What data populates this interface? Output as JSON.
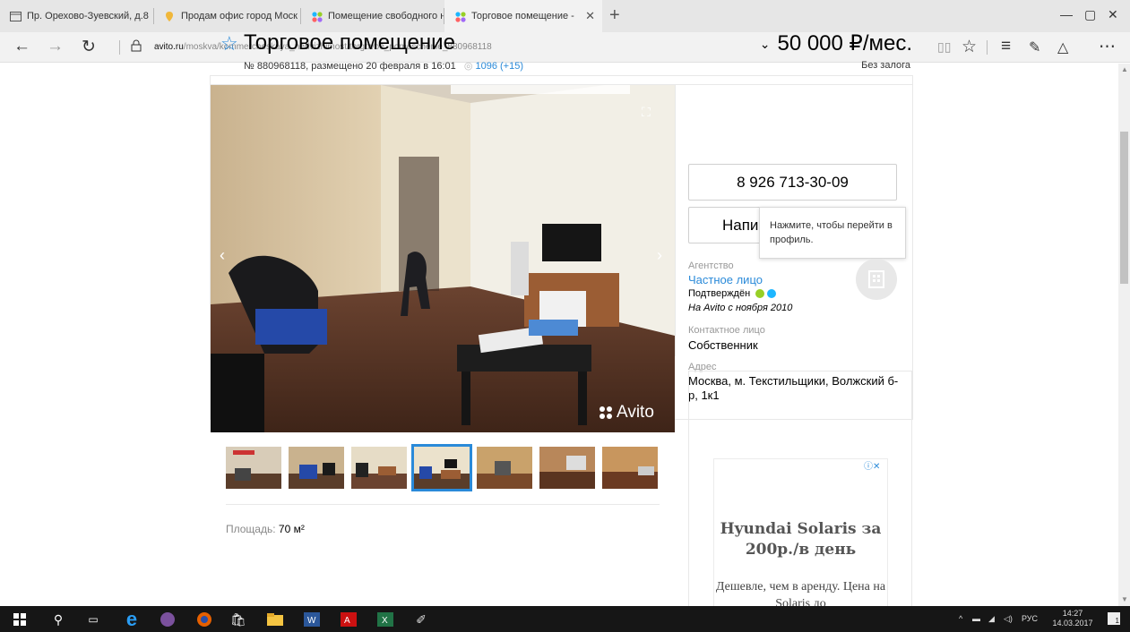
{
  "browser": {
    "tabs": [
      {
        "label": "Пр. Орехово-Зуевский, д.8",
        "icon": "page-icon"
      },
      {
        "label": "Продам офис город Моск",
        "icon": "map-pin-icon"
      },
      {
        "label": "Помещение свободного н",
        "icon": "avito-icon"
      },
      {
        "label": "Торговое помещение -",
        "icon": "avito-icon",
        "active": true
      }
    ],
    "url_domain": "avito.ru",
    "url_path": "/moskva/kommercheskaya_nedvizhimost/torgovoe_pomeschenie_880968118"
  },
  "listing": {
    "title": "Торговое помещение",
    "meta_prefix": "№ 880968118, размещено 20 февраля в 16:01",
    "views": "1096 (+15)",
    "price": "50 000 ₽/мес.",
    "deposit": "Без залога",
    "area_label": "Площадь:",
    "area_value": "70 м²",
    "watermark": "Avito"
  },
  "seller": {
    "phone": "8 926 713-30-09",
    "write_label": "Напис",
    "tooltip": "Нажмите, чтобы перейти в профиль.",
    "agency_label": "Агентство",
    "agency_value": "Частное лицо",
    "confirmed": "Подтверждён",
    "since": "На Avito с ноября 2010",
    "contact_label": "Контактное лицо",
    "contact_value": "Собственник",
    "address_label": "Адрес",
    "address_value": "Москва, м. Текстильщики, Волжский б-р, 1к1"
  },
  "ad": {
    "title": "Hyundai Solaris за 200р./в день",
    "text": "Дешевле, чем в аренду. Цена на Solaris до"
  },
  "taskbar": {
    "lang": "РУС",
    "time": "14:27",
    "date": "14.03.2017",
    "notifications": "1"
  },
  "colors": {
    "accent": "#2a8ad9",
    "taskbar": "#161616"
  }
}
